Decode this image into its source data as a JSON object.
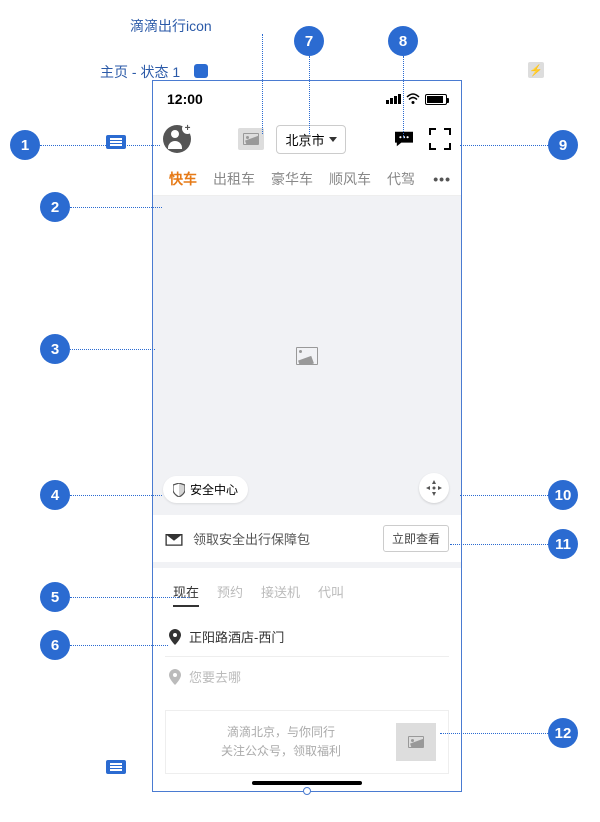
{
  "annotation_top_label": "滴滴出行icon",
  "page_crumb": "主页 - 状态 1",
  "status": {
    "time": "12:00"
  },
  "header": {
    "city": "北京市"
  },
  "service_tabs": [
    "快车",
    "出租车",
    "豪华车",
    "顺风车",
    "代驾"
  ],
  "safety_label": "安全中心",
  "promo": {
    "text": "领取安全出行保障包",
    "button": "立即查看"
  },
  "booking_tabs": [
    "现在",
    "预约",
    "接送机",
    "代叫"
  ],
  "loc_start": "正阳路酒店-西门",
  "loc_end_placeholder": "您要去哪",
  "ad_line1": "滴滴北京，与你同行",
  "ad_line2": "关注公众号，领取福利",
  "badges": {
    "1": "1",
    "2": "2",
    "3": "3",
    "4": "4",
    "5": "5",
    "6": "6",
    "7": "7",
    "8": "8",
    "9": "9",
    "10": "10",
    "11": "11",
    "12": "12"
  }
}
